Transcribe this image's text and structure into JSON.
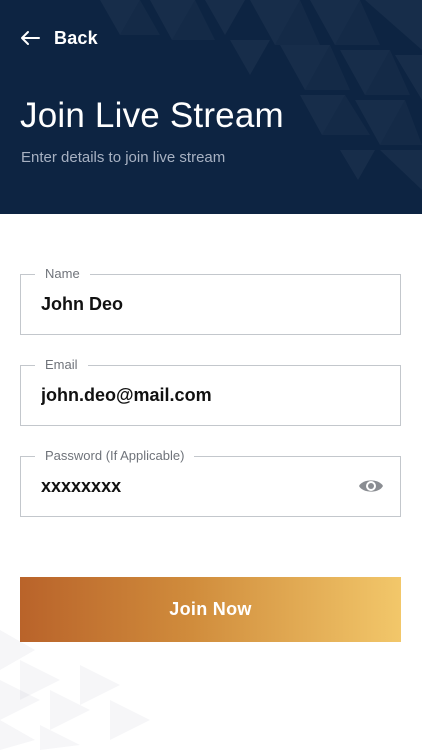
{
  "header": {
    "back_label": "Back",
    "title": "Join Live Stream",
    "subtitle": "Enter details to join live stream"
  },
  "form": {
    "name": {
      "label": "Name",
      "value": "John Deo"
    },
    "email": {
      "label": "Email",
      "value": "john.deo@mail.com"
    },
    "password": {
      "label": "Password (If Applicable)",
      "value": "xxxxxxxx"
    }
  },
  "actions": {
    "join_label": "Join Now"
  },
  "colors": {
    "header_bg": "#0d2442",
    "button_gradient_start": "#b9632a",
    "button_gradient_end": "#f2c76a",
    "field_border": "#c3c7cc"
  },
  "icons": {
    "back": "arrow-left-icon",
    "password_toggle": "eye-icon"
  }
}
